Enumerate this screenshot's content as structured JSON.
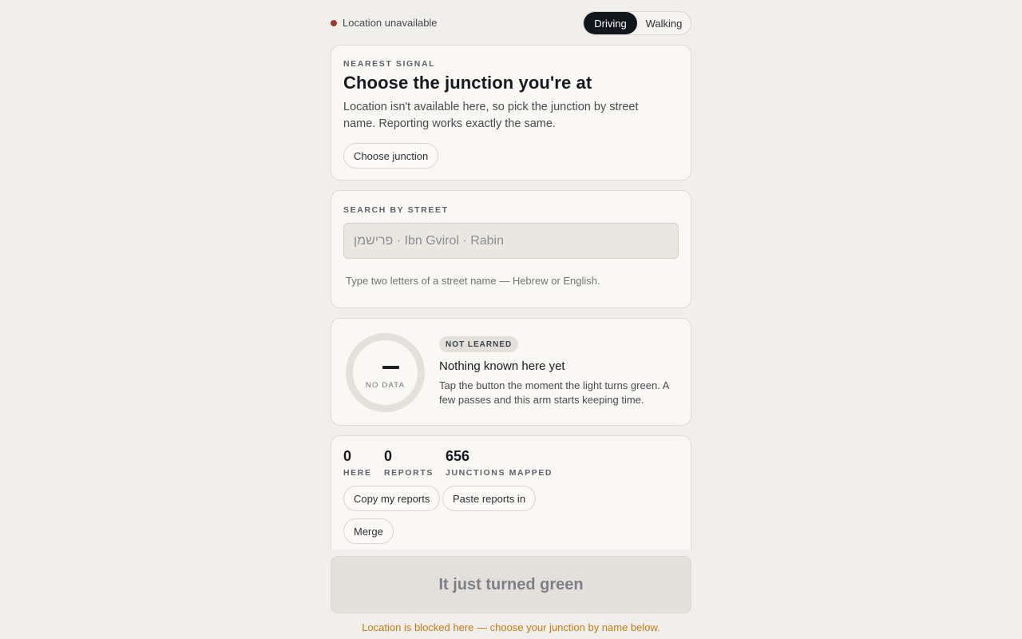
{
  "topbar": {
    "status": "Location unavailable",
    "status_color": "#a13a2a",
    "modes": [
      {
        "label": "Driving",
        "active": true
      },
      {
        "label": "Walking",
        "active": false
      }
    ]
  },
  "nearest": {
    "eyebrow": "Nearest signal",
    "title": "Choose the junction you're at",
    "description": "Location isn't available here, so pick the junction by street name. Reporting works exactly the same.",
    "button": "Choose junction"
  },
  "search": {
    "eyebrow": "Search by street",
    "placeholder": "פרישמן · Ibn Gvirol · Rabin",
    "hint": "Type two letters of a street name — Hebrew or English."
  },
  "signal": {
    "ring_value": "—",
    "ring_label": "No data",
    "badge": "Not learned",
    "title": "Nothing known here yet",
    "description": "Tap the button the moment the light turns green. A few passes and this arm starts keeping time."
  },
  "stats": {
    "items": [
      {
        "value": "0",
        "label": "Here"
      },
      {
        "value": "0",
        "label": "Reports"
      },
      {
        "value": "656",
        "label": "Junctions mapped"
      }
    ],
    "buttons": {
      "copy": "Copy my reports",
      "paste": "Paste reports in",
      "merge": "Merge"
    }
  },
  "cta": {
    "label": "It just turned green"
  },
  "warning": {
    "text": "Location is blocked here — choose your junction by name below.",
    "color": "#c07a18"
  }
}
